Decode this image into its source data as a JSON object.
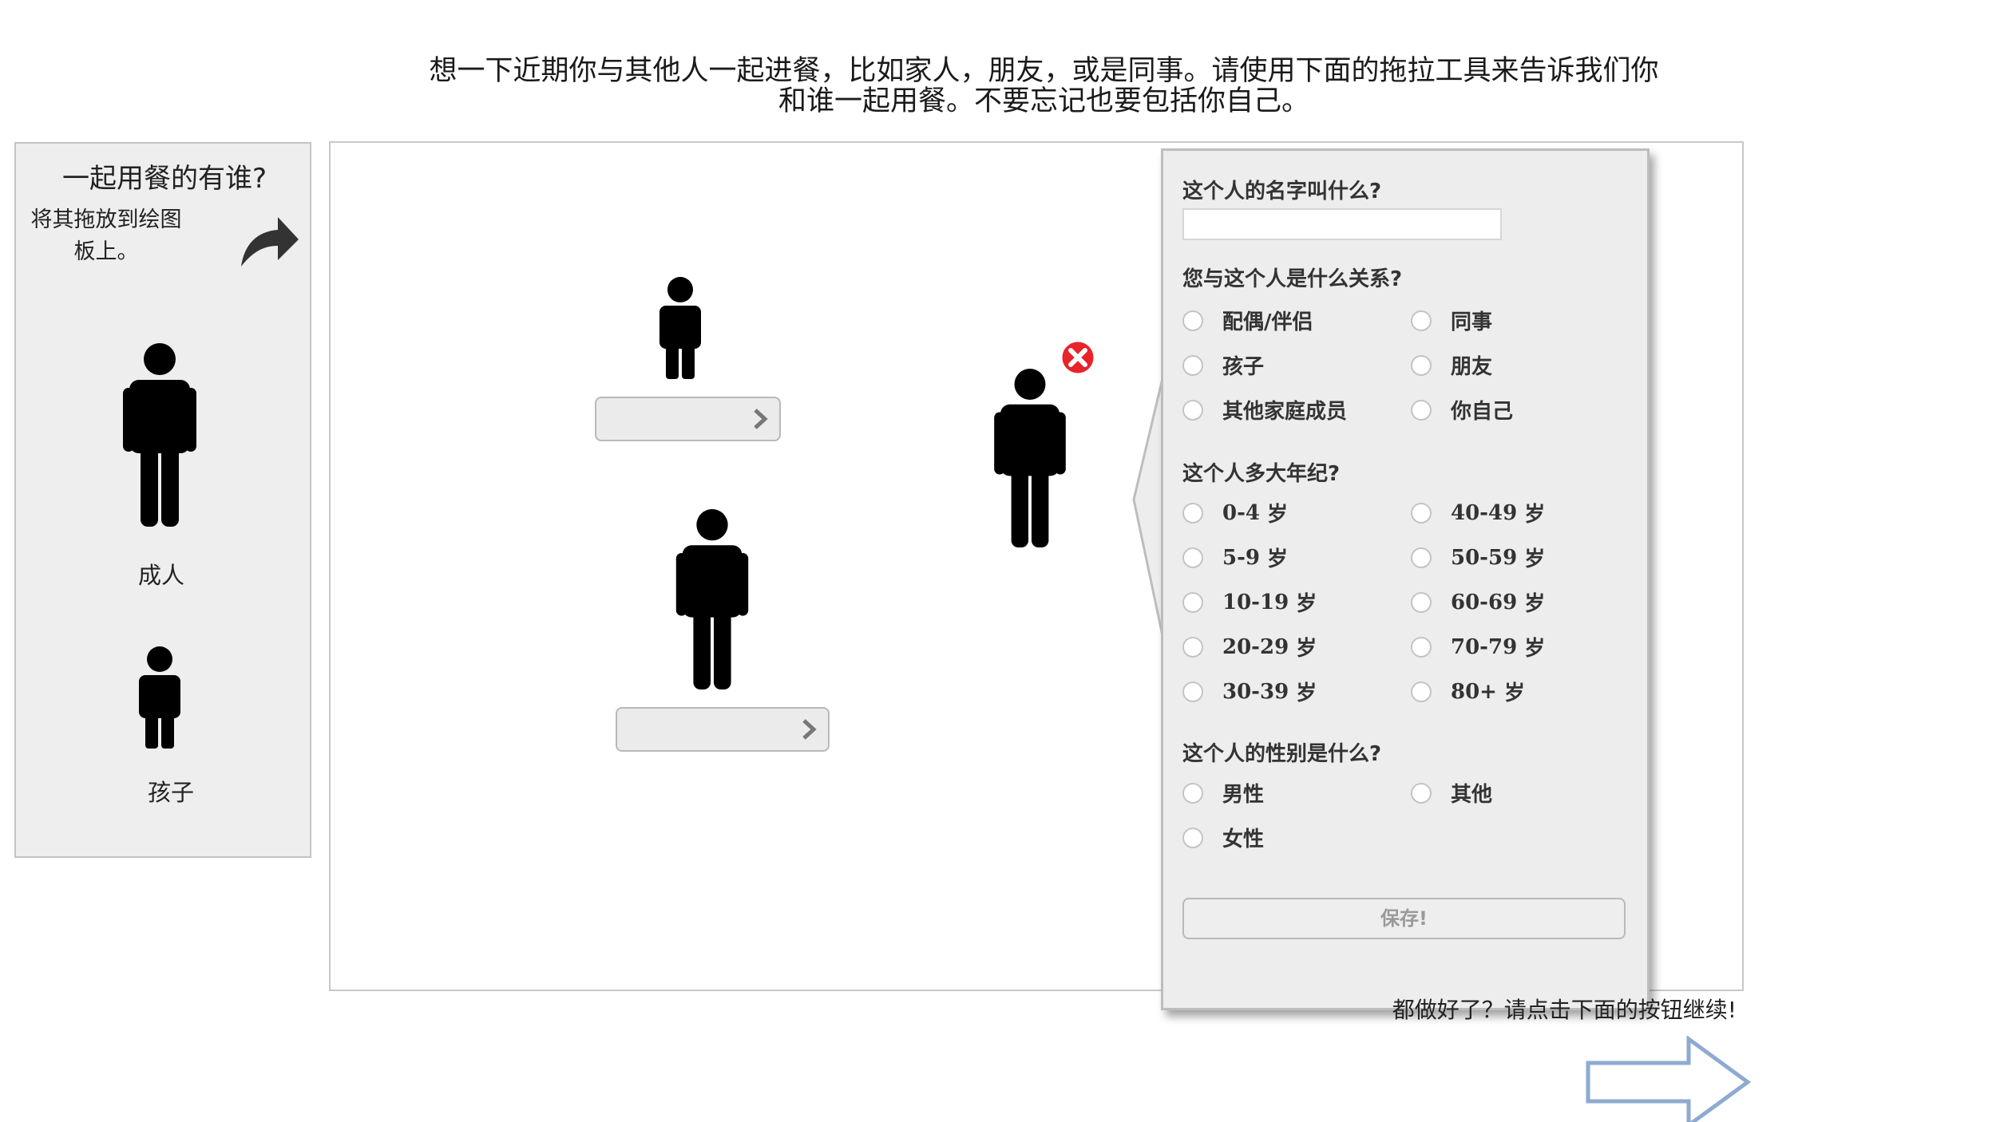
{
  "instructions": {
    "line1": "想一下近期你与其他人一起进餐，比如家人，朋友，或是同事。请使用下面的拖拉工具来告诉我们你",
    "line2": "和谁一起用餐。不要忘记也要包括你自己。"
  },
  "palette": {
    "title": "一起用餐的有谁?",
    "hint": "将其拖放到绘图板上。",
    "items": [
      {
        "label": "成人",
        "icon": "adult-person-icon"
      },
      {
        "label": "孩子",
        "icon": "child-person-icon"
      }
    ]
  },
  "canvas": {
    "people": [
      {
        "type": "child",
        "name": ""
      },
      {
        "type": "adult",
        "name": ""
      },
      {
        "type": "adult",
        "name": "",
        "selected": true
      }
    ]
  },
  "popup": {
    "name_question": "这个人的名字叫什么?",
    "name_value": "",
    "relation_question": "您与这个人是什么关系?",
    "relations": [
      "配偶/伴侣",
      "同事",
      "孩子",
      "朋友",
      "其他家庭成员",
      "你自己"
    ],
    "age_question": "这个人多大年纪?",
    "ages": [
      {
        "num": "0-4",
        "unit": "岁"
      },
      {
        "num": "40-49",
        "unit": "岁"
      },
      {
        "num": "5-9",
        "unit": "岁"
      },
      {
        "num": "50-59",
        "unit": "岁"
      },
      {
        "num": "10-19",
        "unit": "岁"
      },
      {
        "num": "60-69",
        "unit": "岁"
      },
      {
        "num": "20-29",
        "unit": "岁"
      },
      {
        "num": "70-79",
        "unit": "岁"
      },
      {
        "num": "30-39",
        "unit": "岁"
      },
      {
        "num": "80+",
        "unit": "岁"
      }
    ],
    "gender_question": "这个人的性别是什么?",
    "genders": [
      "男性",
      "其他",
      "女性"
    ],
    "save_label": "保存!"
  },
  "footer": {
    "done_text": "都做好了？请点击下面的按钮继续!"
  },
  "colors": {
    "panel_bg": "#eeeeee",
    "delete_red": "#e8232a",
    "next_arrow_stroke": "#8eaad0"
  }
}
